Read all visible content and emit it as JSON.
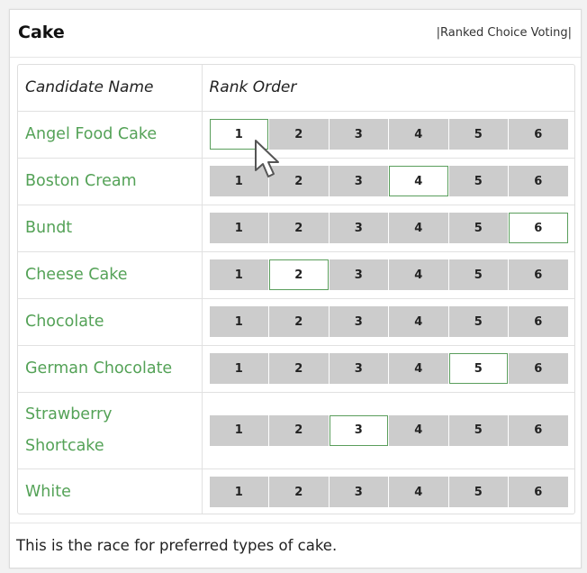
{
  "race": {
    "title": "Cake",
    "method": "|Ranked Choice Voting|",
    "description": "This is the race for preferred types of cake."
  },
  "table": {
    "headers": {
      "candidate": "Candidate Name",
      "rank": "Rank Order"
    },
    "rank_labels": [
      "1",
      "2",
      "3",
      "4",
      "5",
      "6"
    ],
    "candidates": [
      {
        "name": "Angel Food Cake",
        "selected_rank": 1
      },
      {
        "name": "Boston Cream",
        "selected_rank": 4
      },
      {
        "name": "Bundt",
        "selected_rank": 6
      },
      {
        "name": "Cheese Cake",
        "selected_rank": 2
      },
      {
        "name": "Chocolate",
        "selected_rank": null
      },
      {
        "name": "German Chocolate",
        "selected_rank": 5
      },
      {
        "name": "Strawberry Shortcake",
        "selected_rank": 3
      },
      {
        "name": "White",
        "selected_rank": null
      }
    ]
  },
  "colors": {
    "accent_green": "#54a257",
    "selected_border": "#5a9e5c",
    "button_gray": "#cccccc"
  },
  "cursor": {
    "icon": "mouse-pointer-icon"
  }
}
